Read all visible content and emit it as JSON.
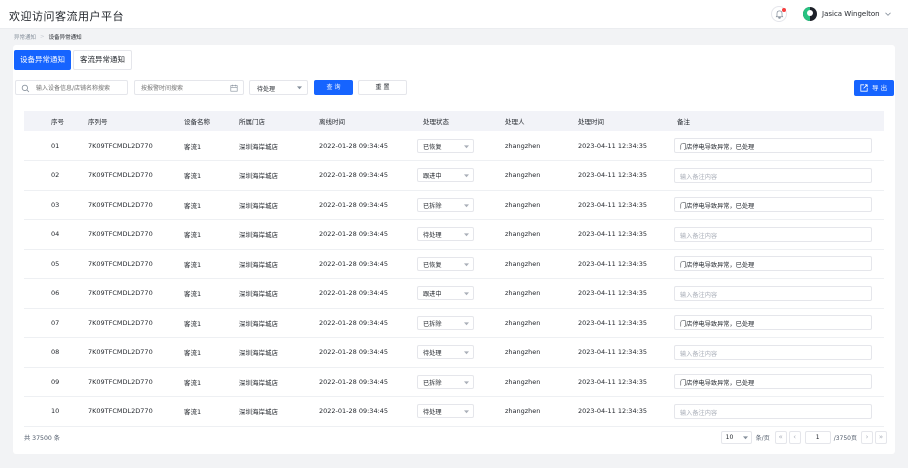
{
  "header": {
    "title": "欢迎访问客流用户平台",
    "user_name": "Jasica Wingelton"
  },
  "breadcrumb": [
    "异常通知",
    "设备异常通知"
  ],
  "tabs": [
    {
      "label": "设备异常通知",
      "active": true
    },
    {
      "label": "客流异常通知",
      "active": false
    }
  ],
  "filters": {
    "search_placeholder": "输入设备信息/店铺名称搜索",
    "date_placeholder": "按报警时间搜索",
    "status_value": "待处理",
    "query_label": "查 询",
    "reset_label": "重 置",
    "export_label": "导 出"
  },
  "table": {
    "columns": [
      "序号",
      "序列号",
      "设备名称",
      "所属门店",
      "离线时间",
      "处理状态",
      "处理人",
      "处理时间",
      "备注"
    ],
    "rows": [
      {
        "index": "01",
        "serial": "7K09TFCMDL2D770",
        "device": "客流1",
        "store": "深圳海岸城店",
        "offline": "2022-01-28 09:34:45",
        "status": "已恢复",
        "handler": "zhangzhen",
        "handled": "2023-04-11 12:34:35",
        "note": "门店停电导致异常，已处理",
        "note_placeholder": ""
      },
      {
        "index": "02",
        "serial": "7K09TFCMDL2D770",
        "device": "客流1",
        "store": "深圳海岸城店",
        "offline": "2022-01-28 09:34:45",
        "status": "跟进中",
        "handler": "zhangzhen",
        "handled": "2023-04-11 12:34:35",
        "note": "",
        "note_placeholder": "输入备注内容"
      },
      {
        "index": "03",
        "serial": "7K09TFCMDL2D770",
        "device": "客流1",
        "store": "深圳海岸城店",
        "offline": "2022-01-28 09:34:45",
        "status": "已拆除",
        "handler": "zhangzhen",
        "handled": "2023-04-11 12:34:35",
        "note": "门店停电导致异常，已处理",
        "note_placeholder": ""
      },
      {
        "index": "04",
        "serial": "7K09TFCMDL2D770",
        "device": "客流1",
        "store": "深圳海岸城店",
        "offline": "2022-01-28 09:34:45",
        "status": "待处理",
        "handler": "zhangzhen",
        "handled": "2023-04-11 12:34:35",
        "note": "",
        "note_placeholder": "输入备注内容"
      },
      {
        "index": "05",
        "serial": "7K09TFCMDL2D770",
        "device": "客流1",
        "store": "深圳海岸城店",
        "offline": "2022-01-28 09:34:45",
        "status": "已恢复",
        "handler": "zhangzhen",
        "handled": "2023-04-11 12:34:35",
        "note": "门店停电导致异常，已处理",
        "note_placeholder": ""
      },
      {
        "index": "06",
        "serial": "7K09TFCMDL2D770",
        "device": "客流1",
        "store": "深圳海岸城店",
        "offline": "2022-01-28 09:34:45",
        "status": "跟进中",
        "handler": "zhangzhen",
        "handled": "2023-04-11 12:34:35",
        "note": "",
        "note_placeholder": "输入备注内容"
      },
      {
        "index": "07",
        "serial": "7K09TFCMDL2D770",
        "device": "客流1",
        "store": "深圳海岸城店",
        "offline": "2022-01-28 09:34:45",
        "status": "已拆除",
        "handler": "zhangzhen",
        "handled": "2023-04-11 12:34:35",
        "note": "门店停电导致异常，已处理",
        "note_placeholder": ""
      },
      {
        "index": "08",
        "serial": "7K09TFCMDL2D770",
        "device": "客流1",
        "store": "深圳海岸城店",
        "offline": "2022-01-28 09:34:45",
        "status": "待处理",
        "handler": "zhangzhen",
        "handled": "2023-04-11 12:34:35",
        "note": "",
        "note_placeholder": "输入备注内容"
      },
      {
        "index": "09",
        "serial": "7K09TFCMDL2D770",
        "device": "客流1",
        "store": "深圳海岸城店",
        "offline": "2022-01-28 09:34:45",
        "status": "已拆除",
        "handler": "zhangzhen",
        "handled": "2023-04-11 12:34:35",
        "note": "门店停电导致异常，已处理",
        "note_placeholder": ""
      },
      {
        "index": "10",
        "serial": "7K09TFCMDL2D770",
        "device": "客流1",
        "store": "深圳海岸城店",
        "offline": "2022-01-28 09:34:45",
        "status": "待处理",
        "handler": "zhangzhen",
        "handled": "2023-04-11 12:34:35",
        "note": "",
        "note_placeholder": "输入备注内容"
      }
    ]
  },
  "footer": {
    "total": "共 37500 条",
    "page_size": "10",
    "page_size_unit": "条/页",
    "current_page": "1",
    "total_pages": "/3750页"
  },
  "colors": {
    "primary": "#1664ff",
    "notification_dot": "#f53f3f",
    "page_bg": "#f2f3f5"
  }
}
